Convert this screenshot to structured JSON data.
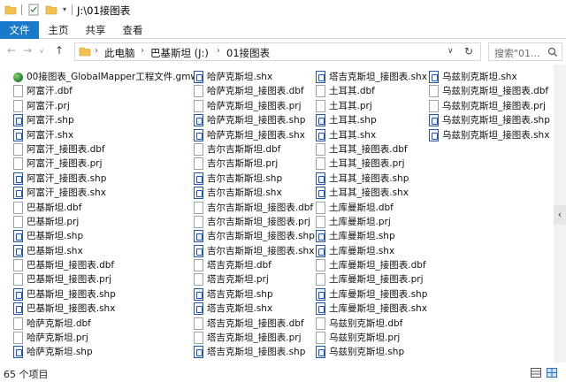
{
  "window": {
    "title": "J:\\01接图表"
  },
  "ribbon": {
    "tabs": [
      "文件",
      "主页",
      "共享",
      "查看"
    ]
  },
  "address": {
    "crumbs": [
      "此电脑",
      "巴基斯坦 (J:)",
      "01接图表"
    ]
  },
  "search": {
    "placeholder": "搜索\"01..."
  },
  "files": {
    "col1": [
      {
        "name": "00接图表_GlobalMapper工程文件.gmw",
        "type": "gmw"
      },
      {
        "name": "阿富汗.dbf",
        "type": "doc"
      },
      {
        "name": "阿富汗.prj",
        "type": "doc"
      },
      {
        "name": "阿富汗.shp",
        "type": "shp"
      },
      {
        "name": "阿富汗.shx",
        "type": "shx"
      },
      {
        "name": "阿富汗_接图表.dbf",
        "type": "doc"
      },
      {
        "name": "阿富汗_接图表.prj",
        "type": "doc"
      },
      {
        "name": "阿富汗_接图表.shp",
        "type": "shp"
      },
      {
        "name": "阿富汗_接图表.shx",
        "type": "shx"
      },
      {
        "name": "巴基斯坦.dbf",
        "type": "doc"
      },
      {
        "name": "巴基斯坦.prj",
        "type": "doc"
      },
      {
        "name": "巴基斯坦.shp",
        "type": "shp"
      },
      {
        "name": "巴基斯坦.shx",
        "type": "shx"
      },
      {
        "name": "巴基斯坦_接图表.dbf",
        "type": "doc"
      },
      {
        "name": "巴基斯坦_接图表.prj",
        "type": "doc"
      },
      {
        "name": "巴基斯坦_接图表.shp",
        "type": "shp"
      },
      {
        "name": "巴基斯坦_接图表.shx",
        "type": "shx"
      },
      {
        "name": "哈萨克斯坦.dbf",
        "type": "doc"
      },
      {
        "name": "哈萨克斯坦.prj",
        "type": "doc"
      },
      {
        "name": "哈萨克斯坦.shp",
        "type": "shp"
      }
    ],
    "col2": [
      {
        "name": "哈萨克斯坦.shx",
        "type": "shx"
      },
      {
        "name": "哈萨克斯坦_接图表.dbf",
        "type": "doc"
      },
      {
        "name": "哈萨克斯坦_接图表.prj",
        "type": "doc"
      },
      {
        "name": "哈萨克斯坦_接图表.shp",
        "type": "shp"
      },
      {
        "name": "哈萨克斯坦_接图表.shx",
        "type": "shx"
      },
      {
        "name": "吉尔吉斯斯坦.dbf",
        "type": "doc"
      },
      {
        "name": "吉尔吉斯斯坦.prj",
        "type": "doc"
      },
      {
        "name": "吉尔吉斯斯坦.shp",
        "type": "shp"
      },
      {
        "name": "吉尔吉斯斯坦.shx",
        "type": "shx"
      },
      {
        "name": "吉尔吉斯斯坦_接图表.dbf",
        "type": "doc"
      },
      {
        "name": "吉尔吉斯斯坦_接图表.prj",
        "type": "doc"
      },
      {
        "name": "吉尔吉斯斯坦_接图表.shp",
        "type": "shp"
      },
      {
        "name": "吉尔吉斯斯坦_接图表.shx",
        "type": "shx"
      },
      {
        "name": "塔吉克斯坦.dbf",
        "type": "doc"
      },
      {
        "name": "塔吉克斯坦.prj",
        "type": "doc"
      },
      {
        "name": "塔吉克斯坦.shp",
        "type": "shp"
      },
      {
        "name": "塔吉克斯坦.shx",
        "type": "shx"
      },
      {
        "name": "塔吉克斯坦_接图表.dbf",
        "type": "doc"
      },
      {
        "name": "塔吉克斯坦_接图表.prj",
        "type": "doc"
      },
      {
        "name": "塔吉克斯坦_接图表.shp",
        "type": "shp"
      }
    ],
    "col3": [
      {
        "name": "塔吉克斯坦_接图表.shx",
        "type": "shx"
      },
      {
        "name": "土耳其.dbf",
        "type": "doc"
      },
      {
        "name": "土耳其.prj",
        "type": "doc"
      },
      {
        "name": "土耳其.shp",
        "type": "shp"
      },
      {
        "name": "土耳其.shx",
        "type": "shx"
      },
      {
        "name": "土耳其_接图表.dbf",
        "type": "doc"
      },
      {
        "name": "土耳其_接图表.prj",
        "type": "doc"
      },
      {
        "name": "土耳其_接图表.shp",
        "type": "shp"
      },
      {
        "name": "土耳其_接图表.shx",
        "type": "shx"
      },
      {
        "name": "土库曼斯坦.dbf",
        "type": "doc"
      },
      {
        "name": "土库曼斯坦.prj",
        "type": "doc"
      },
      {
        "name": "土库曼斯坦.shp",
        "type": "shp"
      },
      {
        "name": "土库曼斯坦.shx",
        "type": "shx"
      },
      {
        "name": "土库曼斯坦_接图表.dbf",
        "type": "doc"
      },
      {
        "name": "土库曼斯坦_接图表.prj",
        "type": "doc"
      },
      {
        "name": "土库曼斯坦_接图表.shp",
        "type": "shp"
      },
      {
        "name": "土库曼斯坦_接图表.shx",
        "type": "shx"
      },
      {
        "name": "乌兹别克斯坦.dbf",
        "type": "doc"
      },
      {
        "name": "乌兹别克斯坦.prj",
        "type": "doc"
      },
      {
        "name": "乌兹别克斯坦.shp",
        "type": "shp"
      }
    ],
    "col4": [
      {
        "name": "乌兹别克斯坦.shx",
        "type": "shx"
      },
      {
        "name": "乌兹别克斯坦_接图表.dbf",
        "type": "doc"
      },
      {
        "name": "乌兹别克斯坦_接图表.prj",
        "type": "doc"
      },
      {
        "name": "乌兹别克斯坦_接图表.shp",
        "type": "shp"
      },
      {
        "name": "乌兹别克斯坦_接图表.shx",
        "type": "shx"
      }
    ]
  },
  "status": {
    "count": "65 个项目"
  },
  "colors": {
    "accent": "#1979ca",
    "folder": "#f4c14e"
  }
}
